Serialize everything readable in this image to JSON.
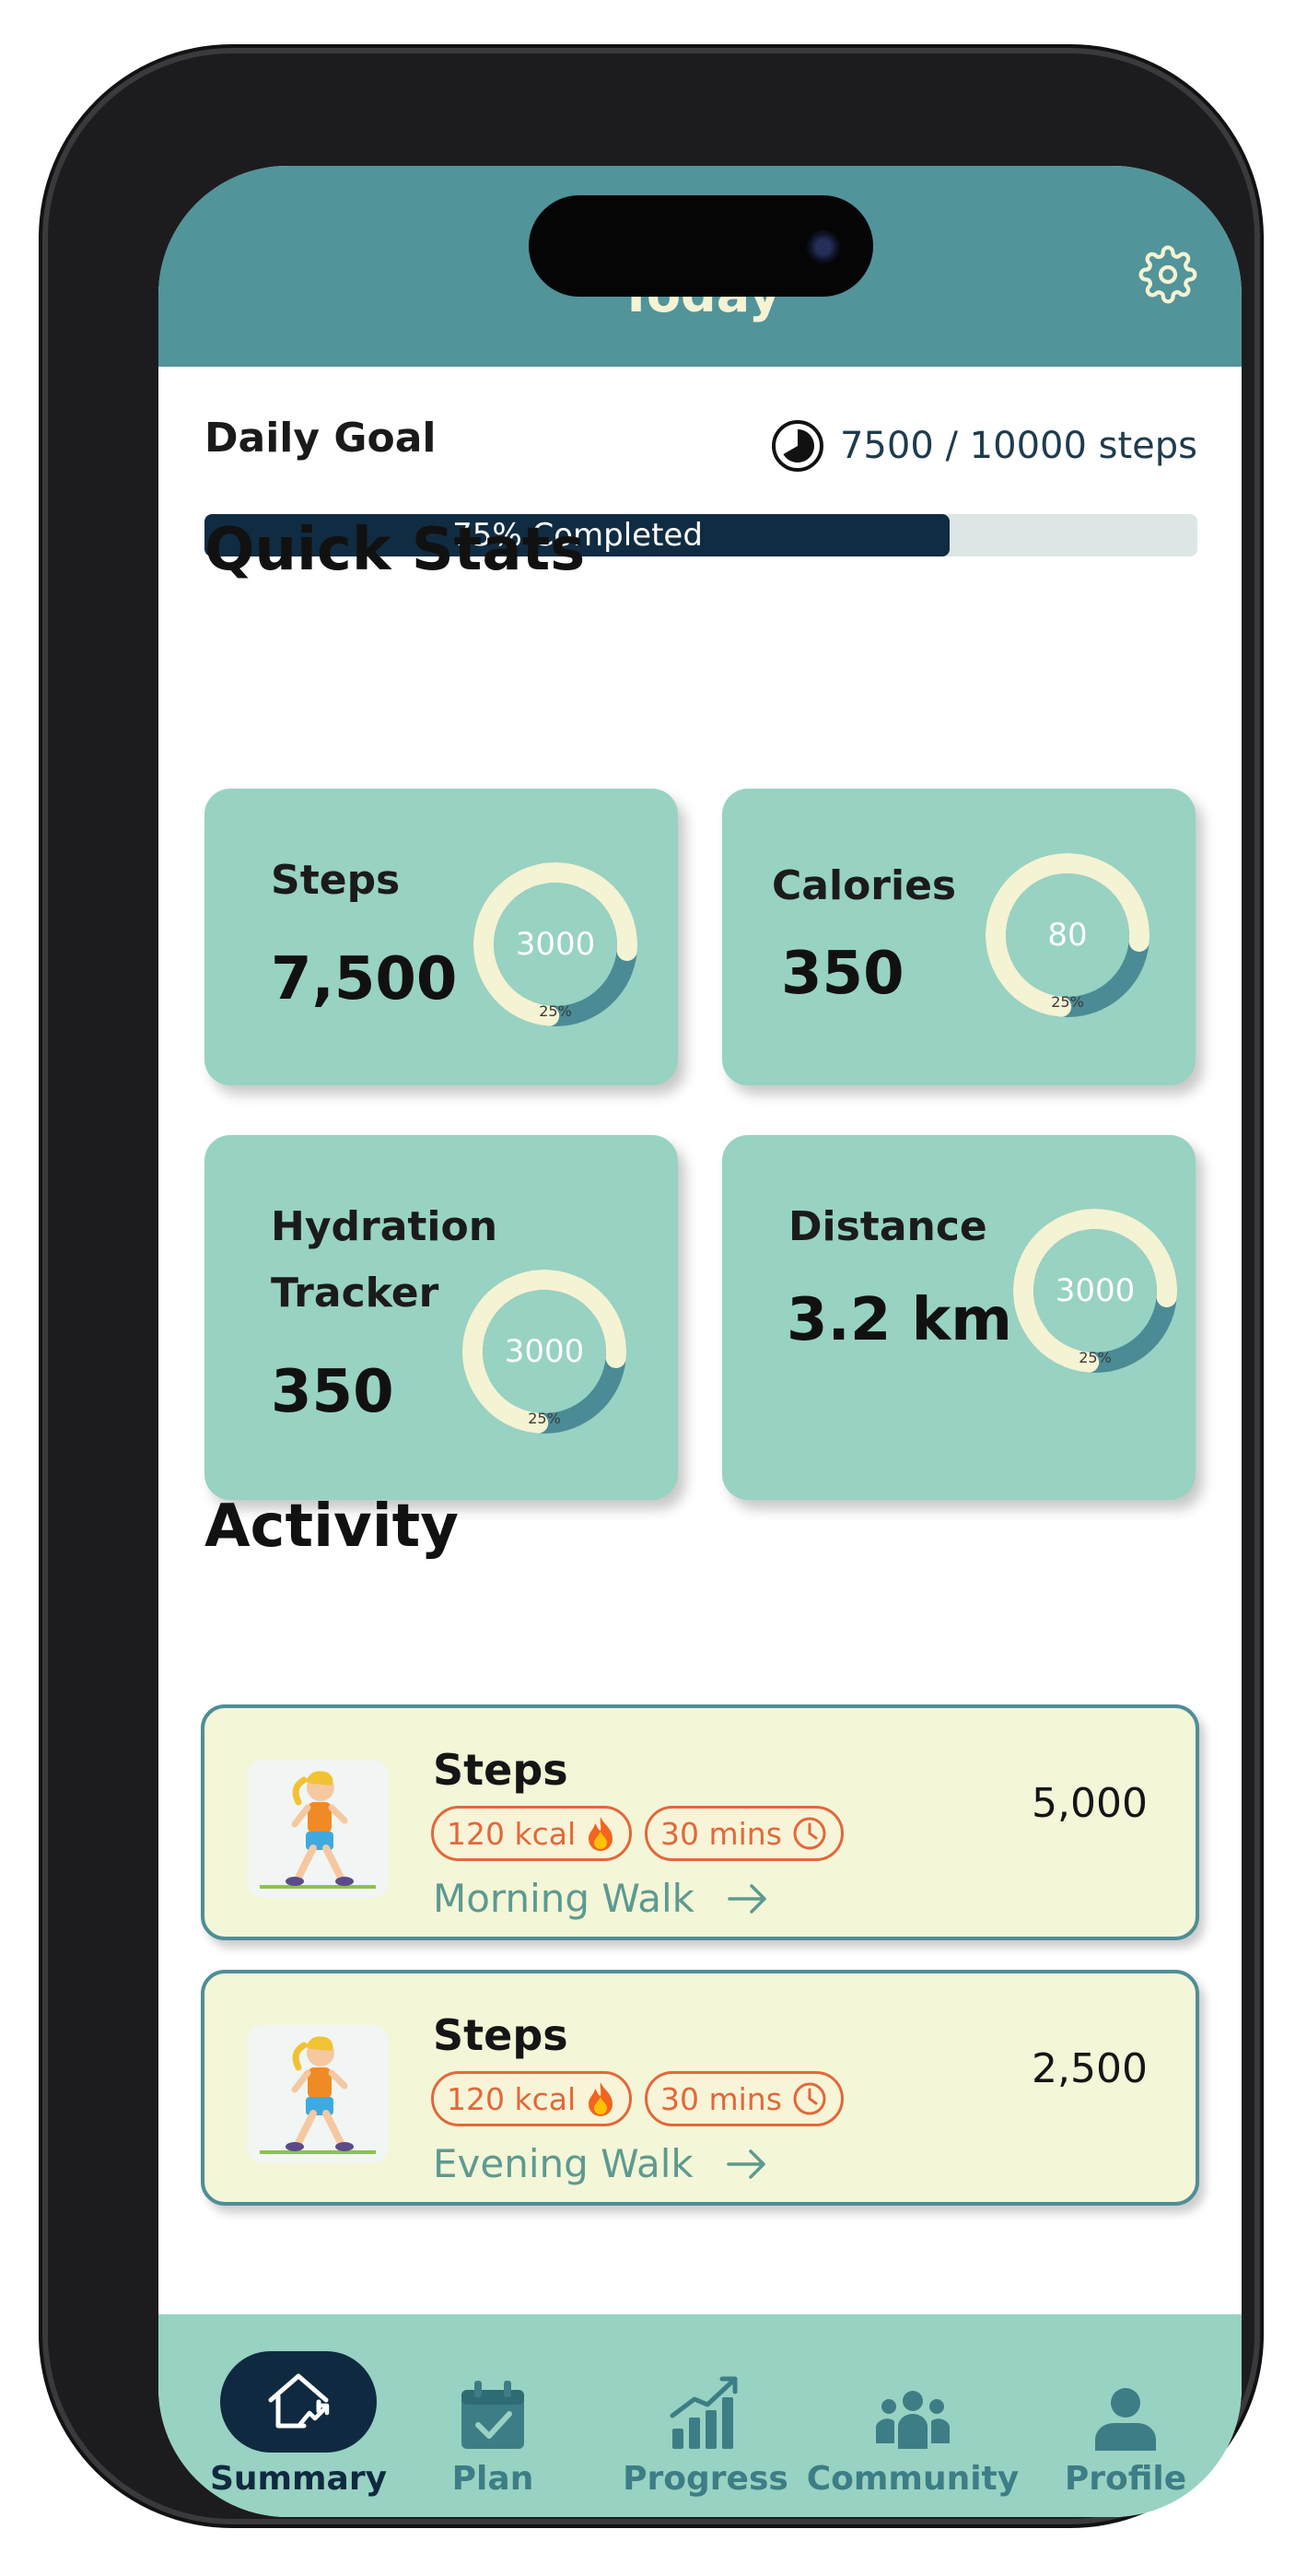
{
  "header": {
    "title": "Today",
    "settings_icon": "gear-icon"
  },
  "daily_goal": {
    "title": "Daily Goal",
    "steps_text": "7500 / 10000 steps",
    "progress_label": "75% Completed",
    "progress_fraction": 0.75
  },
  "quick_stats": {
    "title": "Quick Stats",
    "cards": [
      {
        "label": "Steps",
        "value": "7,500",
        "ring_text": "3000",
        "ring_percent_label": "25%",
        "ring_fraction": 0.75
      },
      {
        "label": "Calories",
        "value": "350",
        "ring_text": "80",
        "ring_percent_label": "25%",
        "ring_fraction": 0.75
      },
      {
        "label_line1": "Hydration",
        "label_line2": "Tracker",
        "value": "350",
        "ring_text": "3000",
        "ring_percent_label": "25%",
        "ring_fraction": 0.75
      },
      {
        "label": "Distance",
        "value": "3.2 km",
        "ring_text": "3000",
        "ring_percent_label": "25%",
        "ring_fraction": 0.75
      }
    ]
  },
  "activity": {
    "title": "Activity",
    "items": [
      {
        "title": "Steps",
        "kcal": "120 kcal",
        "duration": "30 mins",
        "name": "Morning Walk",
        "value": "5,000"
      },
      {
        "title": "Steps",
        "kcal": "120 kcal",
        "duration": "30 mins",
        "name": "Evening Walk",
        "value": "2,500"
      }
    ]
  },
  "nav": {
    "active": "Summary",
    "items": [
      {
        "label": "Summary",
        "icon": "home-chart-icon"
      },
      {
        "label": "Plan",
        "icon": "calendar-check-icon"
      },
      {
        "label": "Progress",
        "icon": "bar-chart-trend-icon"
      },
      {
        "label": "Community",
        "icon": "people-group-icon"
      },
      {
        "label": "Profile",
        "icon": "person-icon"
      }
    ]
  },
  "colors": {
    "header": "#51949a",
    "card": "#98d2c2",
    "navy": "#0f2a40",
    "activity_bg": "#f4f6d8",
    "accent_orange": "#e2683a",
    "ring_light": "#f4f3d3",
    "ring_dark": "#4a8b95"
  }
}
